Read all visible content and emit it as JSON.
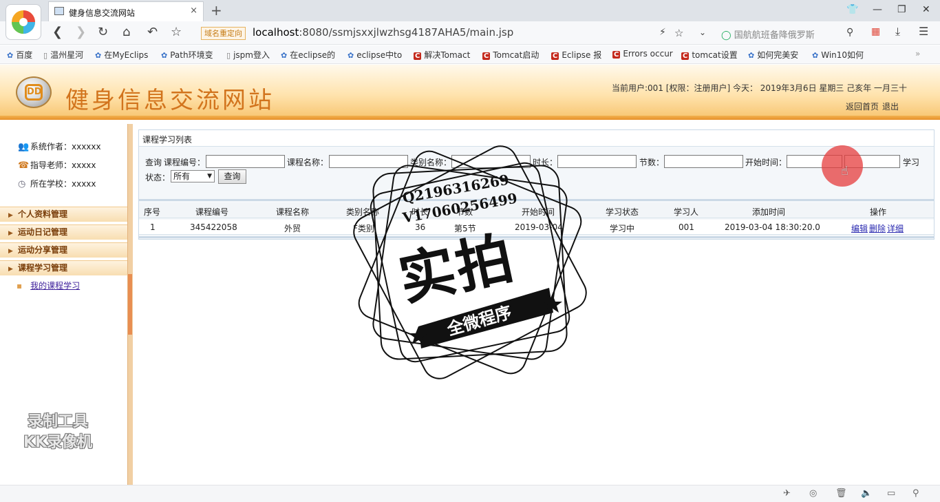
{
  "browser": {
    "tab_title": "健身信息交流网站",
    "tab_close": "×",
    "new_tab": "+",
    "redirect_badge": "域名重定向",
    "url_host": "localhost",
    "url_path": ":8080/ssmjsxxjlwzhsg4187AHA5/main.jsp",
    "search_text": "国航航班备降俄罗斯",
    "bookmarks": [
      "百度",
      "温州星河",
      "在MyEclips",
      "Path环境变",
      "jspm登入",
      "在eclipse的",
      "eclipse中to",
      "解决Tomact",
      "Tomcat启动",
      "Eclipse 报",
      "Errors occur",
      "tomcat设置",
      "如何完美安",
      "Win10如何"
    ],
    "bookmark_more": "»"
  },
  "site": {
    "title": "健身信息交流网站",
    "logo_text": "DD",
    "user_info": "当前用户:001 [权限：注册用户] 今天： 2019年3月6日 星期三 己亥年 一月三十",
    "home_link": "返回首页",
    "logout_link": "退出"
  },
  "sidebar": {
    "info": [
      {
        "label": "系统作者：xxxxxx",
        "icon": "users-icon"
      },
      {
        "label": "指导老师：xxxxx",
        "icon": "teacher-icon"
      },
      {
        "label": "所在学校：xxxxx",
        "icon": "clock-icon"
      }
    ],
    "menu": [
      "个人资料管理",
      "运动日记管理",
      "运动分享管理",
      "课程学习管理"
    ],
    "sub_item": "我的课程学习"
  },
  "panel": {
    "title": "课程学习列表",
    "filters": {
      "query_prefix": "查询",
      "course_no": "课程编号：",
      "course_name": "课程名称：",
      "category": "类别名称：",
      "duration": "时长：",
      "sections": "节数：",
      "start_time": "开始时间：",
      "study_label": "学习",
      "status_label": "状态：",
      "status_value": "所有",
      "query_button": "查询"
    },
    "columns": [
      "序号",
      "课程编号",
      "课程名称",
      "类别名称",
      "时长",
      "节数",
      "开始时间",
      "学习状态",
      "学习人",
      "添加时间",
      "操作"
    ],
    "rows": [
      {
        "no": "1",
        "code": "345422058",
        "name": "外贸",
        "category": "F类别",
        "duration": "36",
        "sections": "第5节",
        "start": "2019-03-04",
        "status": "学习中",
        "learner": "001",
        "added": "2019-03-04 18:30:20.0",
        "actions": [
          "编辑",
          "删除",
          "详细"
        ]
      }
    ]
  },
  "watermark": {
    "qq": "Q2196316269",
    "v": "V17060256499",
    "big": "实拍",
    "banner": "全微程序",
    "recorder_line1": "录制工具",
    "recorder_line2": "KK录像机"
  }
}
